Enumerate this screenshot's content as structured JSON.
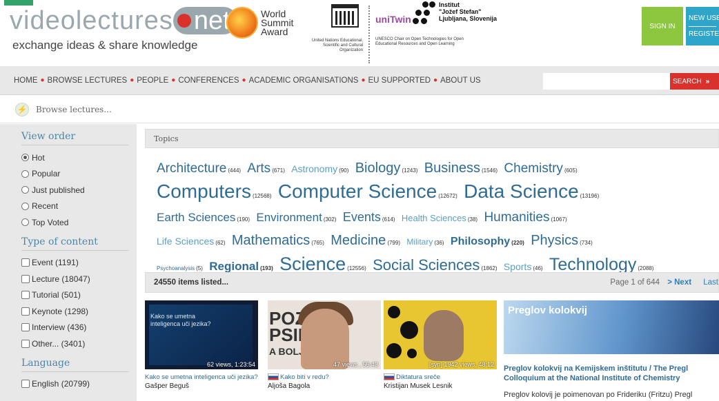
{
  "header": {
    "logo": {
      "part1": "videolectures",
      "part2": "net",
      "tagline": "exchange ideas & share knowledge"
    },
    "wsa": {
      "line1": "World",
      "line2": "Summit",
      "line3": "Award"
    },
    "unesco": {
      "caption": "United Nations Educational, Scientific and Cultural Organization"
    },
    "unitwin": {
      "logo": "uniTwin",
      "caption": "UNESCO Chair on Open Technologies for Open Educational Resources and Open Learning"
    },
    "ijs": {
      "line1": "Institut",
      "line2": "\"Jožef Stefan\"",
      "line3": "Ljubljana, Slovenija"
    },
    "signin": "SIGN IN",
    "newuser1": "NEW USE",
    "newuser2": "REGISTE"
  },
  "nav": {
    "items": [
      "HOME",
      "BROWSE LECTURES",
      "PEOPLE",
      "CONFERENCES",
      "ACADEMIC ORGANISATIONS",
      "EU SUPPORTED",
      "ABOUT US"
    ],
    "search_button": "SEARCH",
    "search_arrow": "»"
  },
  "browse": {
    "label": "Browse lectures..."
  },
  "sidebar": {
    "view_order": {
      "title": "View order",
      "options": [
        {
          "label": "Hot",
          "selected": true
        },
        {
          "label": "Popular",
          "selected": false
        },
        {
          "label": "Just published",
          "selected": false
        },
        {
          "label": "Recent",
          "selected": false
        },
        {
          "label": "Top Voted",
          "selected": false
        }
      ]
    },
    "type": {
      "title": "Type of content",
      "options": [
        "Event (1191)",
        "Lecture (18047)",
        "Tutorial (501)",
        "Keynote (1298)",
        "Interview (436)",
        "Other... (3401)"
      ]
    },
    "language": {
      "title": "Language",
      "options": [
        "English (20799)"
      ]
    }
  },
  "topics": {
    "title": "Topics",
    "tags": [
      {
        "name": "Architecture",
        "count": "(444)"
      },
      {
        "name": "Arts",
        "count": "(671)"
      },
      {
        "name": "Astronomy",
        "count": "(90)"
      },
      {
        "name": "Biology",
        "count": "(1243)"
      },
      {
        "name": "Business",
        "count": "(1546)"
      },
      {
        "name": "Chemistry",
        "count": "(605)"
      },
      {
        "name": "Computers",
        "count": "(12568)"
      },
      {
        "name": "Computer Science",
        "count": "(12672)"
      },
      {
        "name": "Data Science",
        "count": "(13196)"
      },
      {
        "name": "Earth Sciences",
        "count": "(190)"
      },
      {
        "name": "Environment",
        "count": "(302)"
      },
      {
        "name": "Events",
        "count": "(614)"
      },
      {
        "name": "Health Sciences",
        "count": "(38)"
      },
      {
        "name": "Humanities",
        "count": "(1067)"
      },
      {
        "name": "Life Sciences",
        "count": "(62)"
      },
      {
        "name": "Mathematics",
        "count": "(765)"
      },
      {
        "name": "Medicine",
        "count": "(799)"
      },
      {
        "name": "Military",
        "count": "(36)"
      },
      {
        "name": "Philosophy",
        "count": "(220)"
      },
      {
        "name": "Physics",
        "count": "(734)"
      },
      {
        "name": "Psychoanalysis",
        "count": "(5)"
      },
      {
        "name": "Regional",
        "count": "(193)"
      },
      {
        "name": "Science",
        "count": "(12556)"
      },
      {
        "name": "Social Sciences",
        "count": "(1862)"
      },
      {
        "name": "Sports",
        "count": "(46)"
      },
      {
        "name": "Technology",
        "count": "(2088)"
      }
    ]
  },
  "listing": {
    "count": "24550 items listed...",
    "page": "Page 1 of 644",
    "next": "> Next",
    "last": "Last"
  },
  "cards": [
    {
      "slide_text1": "Kako se umetna",
      "slide_text2": "inteligenca uči jezika?",
      "meta": "62 views, 1:23:54",
      "title": "Kako se umetna inteligenca uči jezika?",
      "author": "Gašper Beguš"
    },
    {
      "word1": "POZ",
      "word2": "PSIHO",
      "word3": "A BOLJ",
      "meta": "47 views , 56:43",
      "title": "Kako biti v redu?",
      "author": "Aljoša Bagola"
    },
    {
      "meta": "[syn]  1942 views, 48:12",
      "stars": "★★★★★",
      "title": "Diktatura sreče",
      "author": "Kristijan Musek Lesnik"
    }
  ],
  "featured": {
    "img_title": "Preglov kolokvij",
    "title": "Preglov kolokvij na Kemijskem inštitutu / The Pregl Colloquium at the National Institute of Chemistry",
    "desc": "Preglov kolovij je poimenovan po Frideriku (Fritzu) Pregl"
  },
  "colors": {
    "accent_red": "#d9322c",
    "signin_green": "#8dc63f",
    "newuser_blue": "#2fa6c9",
    "link_blue": "#2e6b95"
  }
}
